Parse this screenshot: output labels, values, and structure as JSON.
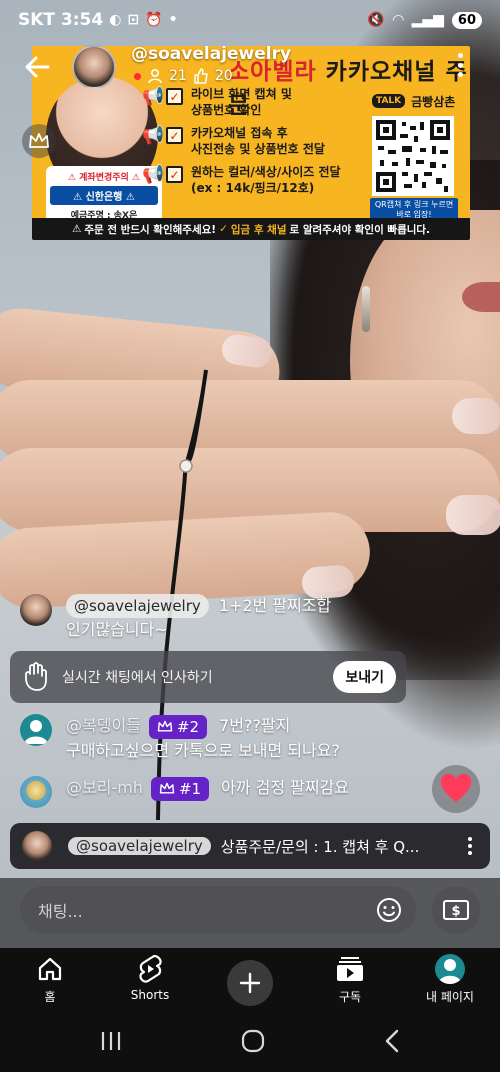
{
  "status_bar": {
    "carrier_time": "SKT 3:54",
    "battery": "60"
  },
  "header": {
    "channel_handle": "@soavelajewelry",
    "viewers": "21",
    "likes": "20"
  },
  "banner": {
    "title_red": "소아벨라",
    "title_black": "카카오채널 주문",
    "bank_warning": "⚠ 계좌변경주의 ⚠",
    "bank_name": "⚠ 신한은행 ⚠",
    "bank_holder": "예금주명 : 송X은",
    "steps": [
      "라이브 화면 캡쳐 및\n상품번호 확인",
      "카카오채널 접속 후\n사진전송 및 상품번호 전달",
      "원하는 컬러/색상/사이즈 전달\n(ex : 14k/핑크/12호)"
    ],
    "kakao_label": "금빵삼촌",
    "kakao_badge": "TALK",
    "qr_note": "QR캡쳐 후 링크 누르면\n바로 입장!",
    "footer_before": "주문 전 반드시 확인해주세요!",
    "footer_highlight": "입금 후 채널",
    "footer_after": "로 알려주셔야 확인이 빠릅니다."
  },
  "chat": {
    "messages": [
      {
        "author": "@soavelajewelry",
        "text_line1": "1+2번 팔찌조합",
        "text_line2": "인기많습니다~"
      },
      {
        "author": "@복뎅이들",
        "badge": "#2",
        "text_line1": "7번??팔지",
        "text_line2": "구매하고싶으면 카톡으로 보내면 되나요?"
      },
      {
        "author": "@보리-mh",
        "badge": "#1",
        "text_line1": "아까 검정 팔찌감요",
        "text_line2": ""
      }
    ],
    "greeting_text": "실시간 채팅에서 인사하기",
    "greeting_button": "보내기",
    "pinned_author": "@soavelajewelry",
    "pinned_text": "상품주문/문의 : 1. 캡쳐 후 Q...",
    "input_placeholder": "채팅..."
  },
  "bottom_nav": {
    "items": [
      {
        "label": "홈",
        "icon": "home-icon"
      },
      {
        "label": "Shorts",
        "icon": "shorts-icon"
      },
      {
        "label": "",
        "icon": "create-icon"
      },
      {
        "label": "구독",
        "icon": "subscriptions-icon"
      },
      {
        "label": "내 페이지",
        "icon": "profile-icon"
      }
    ]
  },
  "colors": {
    "banner_yellow": "#f6b521",
    "member_badge": "#6523c7",
    "like_heart": "#ff3b5c",
    "bank_blue": "#0a4ea3"
  }
}
